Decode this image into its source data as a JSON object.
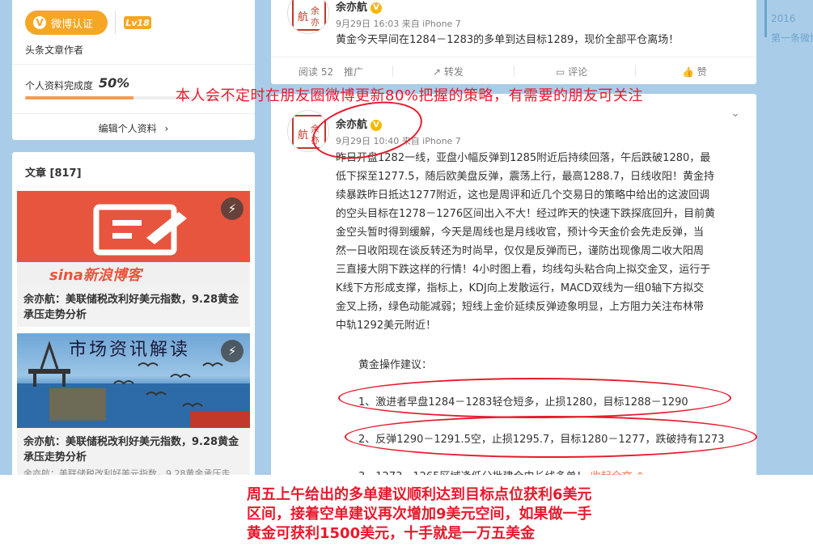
{
  "profile": {
    "verify_label": "微博认证",
    "verify_icon": "v-icon",
    "level": "Lv18",
    "author_type": "头条文章作者",
    "completion_label": "个人资料完成度",
    "completion_value": "50%",
    "completion_fraction": 0.5,
    "edit_label": "编辑个人资料",
    "edit_arrow": "›"
  },
  "articles": {
    "title": "文章 [817]",
    "items": [
      {
        "thumb_text": "sina新浪博客",
        "title": "余亦航：美联储税改利好美元指数，9.28黄金承压走势分析",
        "excerpt": ""
      },
      {
        "thumb_text": "市场资讯解读",
        "title": "余亦航：美联储税改利好美元指数，9.28黄金承压走势分析",
        "excerpt": "余亦航：美联储税改利好美元指数，9.28黄金承压走"
      }
    ]
  },
  "post1": {
    "avatar_text": "航 亦 余",
    "author": "余亦航",
    "meta": "9月29日 16:03 来自 iPhone 7",
    "text": "黄金今天早间在1284－1283的多单到达目标1289，现价全部平仓离场！",
    "actions": {
      "reads": "阅读 52",
      "promote": "推广",
      "forward": "转发",
      "comment": "评论",
      "like": "赞"
    }
  },
  "post2": {
    "avatar_text": "航 亦 余",
    "author": "余亦航",
    "meta": "9月29日 10:40 来自 iPhone 7",
    "body_lines": [
      "昨日开盘1282一线，亚盘小幅反弹到1285附近后持续回落，午后跌破1280，最",
      "低下探至1277.5，随后欧美盘反弹，震荡上行，最高1288.7，日线收阳！黄金持",
      "续暴跌昨日抵达1277附近，这也是周评和近几个交易日的策略中给出的这波回调",
      "的空头目标在1278－1276区间出入不大！经过昨天的快速下跌探底回升，目前黄",
      "金空头暂时得到缓解，今天是周线也是月线收官，预计今天金价会先走反弹，当",
      "然一日收阳现在谈反转还为时尚早，仅仅是反弹而已，谨防出现像周二收大阳周",
      "三直接大阴下跌这样的行情！4小时图上看，均线勾头粘合向上拟交金叉，运行于",
      "K线下方形成支撑，指标上，KDJ向上发散运行，MACD双线为一组0轴下方拟交",
      "金叉上扬，绿色动能减弱；短线上金价延续反弹迹象明显，上方阻力关注布林带",
      "中轨1292美元附近！"
    ],
    "suggest_title": "黄金操作建议：",
    "suggestions": [
      "1、激进者早盘1284－1283轻仓短多，止损1280，目标1288－1290",
      "2、反弹1290－1291.5空，止损1295.7，目标1280－1277，跌破持有1273",
      "3、1273－1265区域逢低分批建仓中长线多单！"
    ],
    "collapse_label": "收起全文",
    "collapse_arrow": "⌃"
  },
  "timeline": {
    "year": "2016",
    "item": "第一条微博"
  },
  "overlays": {
    "top_text": "本人会不定时在朋友圈微博更新80%把握的策略，有需要的朋友可关注",
    "bottom_lines": [
      "周五上午给出的多单建议顺利达到目标点位获利6美元",
      "区间，接着空单建议再次增加9美元空间，如果做一手",
      "黄金可获利1500美元，十手就是一万五美金"
    ],
    "color": "#e8192c"
  },
  "colors": {
    "page_bg": "#a9cde8",
    "accent_orange": "#f5a623",
    "link_orange": "#eb7350"
  }
}
